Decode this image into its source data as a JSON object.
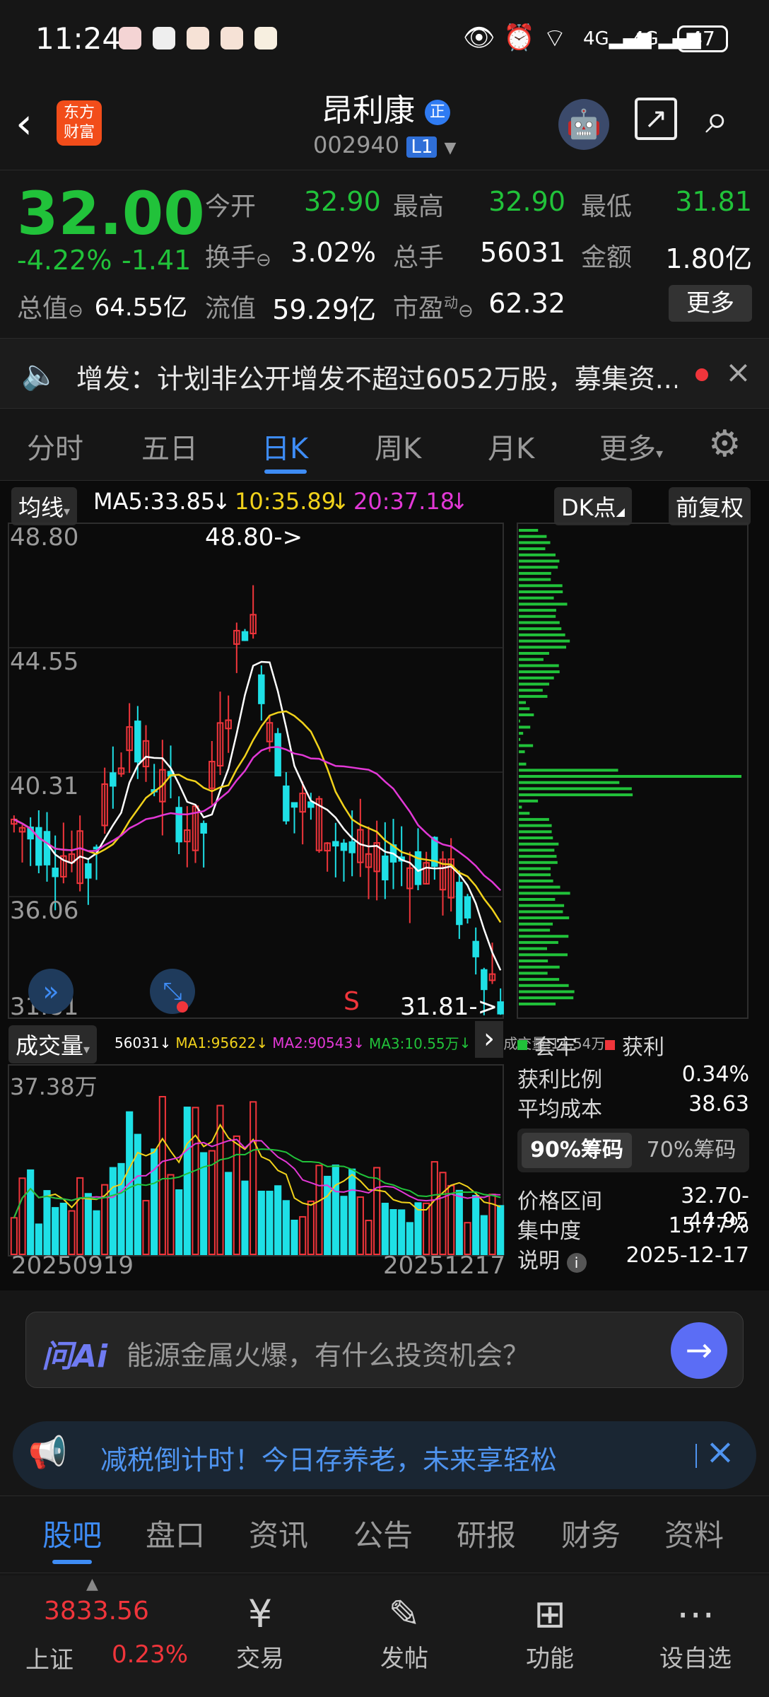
{
  "status_bar": {
    "time": "11:24",
    "battery": "47",
    "net1": "4G",
    "net2": "4G"
  },
  "header": {
    "logo_line1": "东方",
    "logo_line2": "财富",
    "title": "昂利康",
    "title_badge": "正",
    "code": "002940",
    "level": "L1"
  },
  "quote": {
    "price": "32.00",
    "change_pct": "-4.22%",
    "change": "-1.41",
    "open_label": "今开",
    "open": "32.90",
    "high_label": "最高",
    "high": "32.90",
    "low_label": "最低",
    "low": "31.81",
    "turnover_label": "换手",
    "turnover": "3.02%",
    "volume_label": "总手",
    "volume": "56031",
    "amount_label": "金额",
    "amount": "1.80亿",
    "mktcap_label": "总值",
    "mktcap": "64.55亿",
    "float_label": "流值",
    "float": "59.29亿",
    "pe_label": "市盈",
    "pe_sup": "动",
    "pe": "62.32",
    "more": "更多"
  },
  "news": {
    "text": "增发：计划非公开增发不超过6052万股，募集资..."
  },
  "tabs": [
    "分时",
    "五日",
    "日K",
    "周K",
    "月K",
    "更多"
  ],
  "chart": {
    "ma_button": "均线",
    "ma5": "MA5:33.85",
    "ma10": "10:35.89",
    "ma20": "20:37.18",
    "dk_button": "DK点",
    "fq_button": "前复权",
    "y_labels": [
      "48.80",
      "44.55",
      "40.31",
      "36.06",
      "31.81"
    ],
    "high_marker": "48.80->",
    "low_marker": "31.81->",
    "s_marker": "S",
    "vol_button": "成交量",
    "vol_legend": {
      "vol": "56031",
      "ma1": "MA1:95622",
      "ma2": "MA2:90543",
      "ma3": "MA3:10.55万",
      "virtual": "虚拟成交量:11.54万"
    },
    "vol_max": "37.38万",
    "date_start": "20250919",
    "date_end": "20251217",
    "colors": {
      "up": "#f0353b",
      "down": "#1ee0e6",
      "ma5": "#ffffff",
      "ma10": "#f1d21b",
      "ma20": "#e238d6",
      "chip": "#21c23a"
    }
  },
  "chips": {
    "legend_trapped": "套牢",
    "legend_profit": "获利",
    "profit_ratio_label": "获利比例",
    "profit_ratio": "0.34%",
    "avg_cost_label": "平均成本",
    "avg_cost": "38.63",
    "tab90": "90%筹码",
    "tab70": "70%筹码",
    "range_label": "价格区间",
    "range": "32.70-44.95",
    "concentration_label": "集中度",
    "concentration": "15.77%",
    "note_label": "说明",
    "note_date": "2025-12-17"
  },
  "ai": {
    "brand": "问Ai",
    "placeholder": "能源金属火爆，有什么投资机会？"
  },
  "promo": {
    "text": "减税倒计时！今日存养老，未来享轻松"
  },
  "subtabs": [
    "股吧",
    "盘口",
    "资讯",
    "公告",
    "研报",
    "财务",
    "资料"
  ],
  "bottom_nav": {
    "index_value": "3833.56",
    "index_name": "上证",
    "index_change": "0.23%",
    "items": [
      "交易",
      "发帖",
      "功能",
      "设自选"
    ]
  }
}
